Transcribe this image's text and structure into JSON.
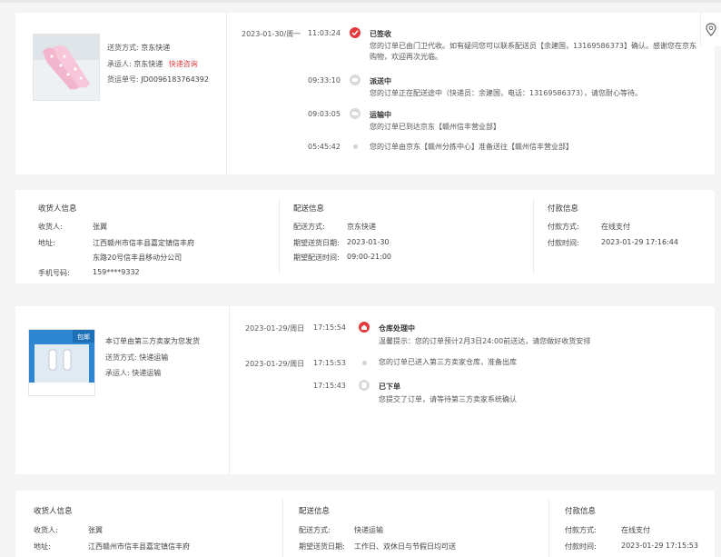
{
  "order1": {
    "delivery_method_label": "送货方式:",
    "delivery_method": "京东快递",
    "carrier_label": "承运人:",
    "carrier": "京东快递",
    "carrier_link": "快递咨询",
    "tracking_label": "货运单号:",
    "tracking_no": "JD0096183764392",
    "timeline": [
      {
        "date": "2023-01-30/周一",
        "time": "11:03:24",
        "status": "已签收",
        "desc": "您的订单已由门卫代收。如有疑问您可以联系配送员【余建国，13169586373】确认。感谢您在京东购物，欢迎再次光临。"
      },
      {
        "date": "",
        "time": "09:33:10",
        "status": "派送中",
        "desc": "您的订单正在配送途中（快递员：余建国，电话：13169586373），请您耐心等待。"
      },
      {
        "date": "",
        "time": "09:03:05",
        "status": "运输中",
        "desc": "您的订单已到达京东【赣州信丰营业部】"
      },
      {
        "date": "",
        "time": "05:45:42",
        "status": "",
        "desc": "您的订单由京东【赣州分拣中心】准备送往【赣州信丰营业部】"
      }
    ]
  },
  "info1": {
    "receiver_title": "收货人信息",
    "receiver_name_label": "收货人:",
    "receiver_name": "张翼",
    "address_label": "地址:",
    "address_line1": "江西赣州市信丰县嘉定镇信丰府",
    "address_line2": "东路20号信丰县移动分公司",
    "phone_label": "手机号码:",
    "phone": "159****9332",
    "delivery_title": "配送信息",
    "delivery_method_label": "配送方式:",
    "delivery_method": "京东快递",
    "expected_date_label": "期望送货日期:",
    "expected_date": "2023-01-30",
    "expected_time_label": "期望配送时间:",
    "expected_time": "09:00-21:00",
    "payment_title": "付款信息",
    "payment_method_label": "付款方式:",
    "payment_method": "在线支付",
    "payment_time_label": "付款时间:",
    "payment_time": "2023-01-29 17:16:44"
  },
  "order2": {
    "badge_text": "包邮",
    "note": "本订单由第三方卖家为您发货",
    "delivery_method_label": "送货方式:",
    "delivery_method": "快递运输",
    "carrier_label": "承运人:",
    "carrier": "快递运输",
    "timeline": [
      {
        "date": "2023-01-29/周日",
        "time": "17:15:54",
        "status": "仓库处理中",
        "desc": "温馨提示：您的订单预计2月3日24:00前送达，请您做好收货安排"
      },
      {
        "date": "2023-01-29/周日",
        "time": "17:15:53",
        "status": "",
        "desc": "您的订单已进入第三方卖家仓库，准备出库"
      },
      {
        "date": "",
        "time": "17:15:43",
        "status": "已下单",
        "desc": "您提交了订单，请等待第三方卖家系统确认"
      }
    ]
  },
  "info2": {
    "receiver_title": "收货人信息",
    "receiver_name_label": "收货人:",
    "receiver_name": "张翼",
    "address_label": "地址:",
    "address_line1": "江西赣州市信丰县嘉定镇信丰府",
    "delivery_title": "配送信息",
    "delivery_method_label": "配送方式:",
    "delivery_method": "快递运输",
    "expected_date_label": "期望送货日期:",
    "expected_date": "工作日、双休日与节假日均可送",
    "payment_title": "付款信息",
    "payment_method_label": "付款方式:",
    "payment_method": "在线支付",
    "payment_time_label": "付款时间:",
    "payment_time": "2023-01-29 17:15:53"
  },
  "colors": {
    "accent": "#e4393c",
    "grey_dot": "#d3d3d3"
  }
}
